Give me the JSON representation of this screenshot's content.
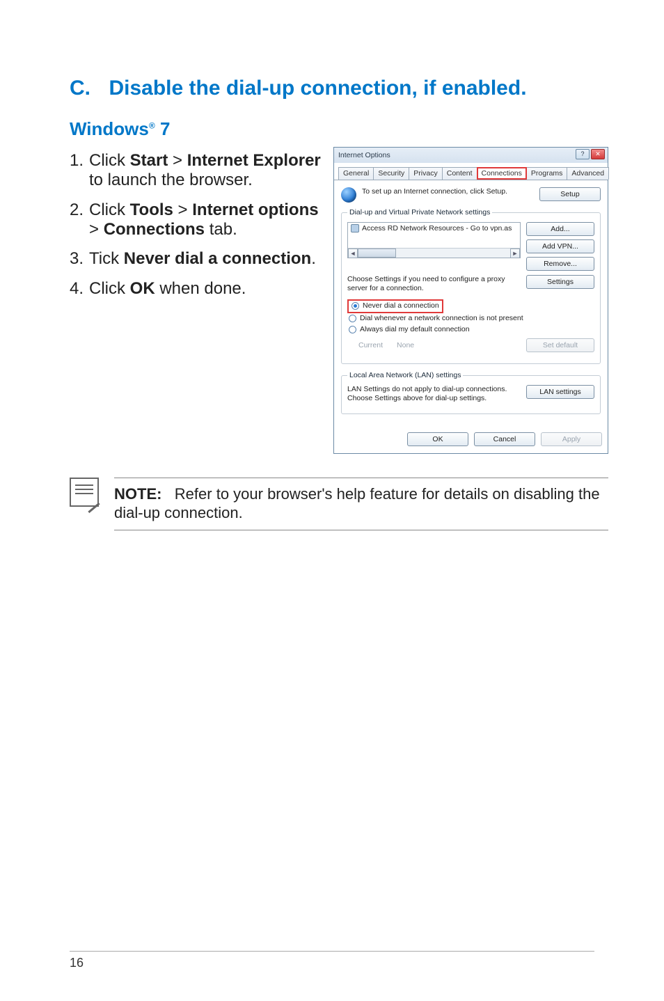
{
  "section": {
    "letter": "C.",
    "title": "Disable the dial-up connection, if enabled."
  },
  "subtitle": {
    "prefix": "Windows",
    "reg": "®",
    "suffix": " 7"
  },
  "steps": [
    {
      "num": "1.",
      "parts": [
        "Click ",
        "Start",
        " > ",
        "Internet Explorer",
        " to launch the browser."
      ]
    },
    {
      "num": "2.",
      "parts": [
        "Click ",
        "Tools",
        " > ",
        "Internet options",
        " > ",
        "Connections",
        " tab."
      ]
    },
    {
      "num": "3.",
      "parts": [
        "Tick ",
        "Never dial a connection",
        "."
      ]
    },
    {
      "num": "4.",
      "parts": [
        "Click ",
        "OK",
        " when done."
      ]
    }
  ],
  "dialog": {
    "title": "Internet Options",
    "tabs": [
      "General",
      "Security",
      "Privacy",
      "Content",
      "Connections",
      "Programs",
      "Advanced"
    ],
    "active_tab": "Connections",
    "setup_text": "To set up an Internet connection, click Setup.",
    "setup_btn": "Setup",
    "dialup_legend": "Dial-up and Virtual Private Network settings",
    "conn_item": "Access RD Network Resources - Go to vpn.as",
    "btn_add": "Add...",
    "btn_addvpn": "Add VPN...",
    "btn_remove": "Remove...",
    "proxy_text": "Choose Settings if you need to configure a proxy server for a connection.",
    "btn_settings": "Settings",
    "radio_never": "Never dial a connection",
    "radio_dial_when": "Dial whenever a network connection is not present",
    "radio_always": "Always dial my default connection",
    "current_label": "Current",
    "current_value": "None",
    "btn_setdefault": "Set default",
    "lan_legend": "Local Area Network (LAN) settings",
    "lan_text": "LAN Settings do not apply to dial-up connections. Choose Settings above for dial-up settings.",
    "btn_lan": "LAN settings",
    "btn_ok": "OK",
    "btn_cancel": "Cancel",
    "btn_apply": "Apply"
  },
  "note": {
    "label": "NOTE:",
    "text": "Refer to your browser's help feature for details on disabling the dial-up connection."
  },
  "page_number": "16"
}
